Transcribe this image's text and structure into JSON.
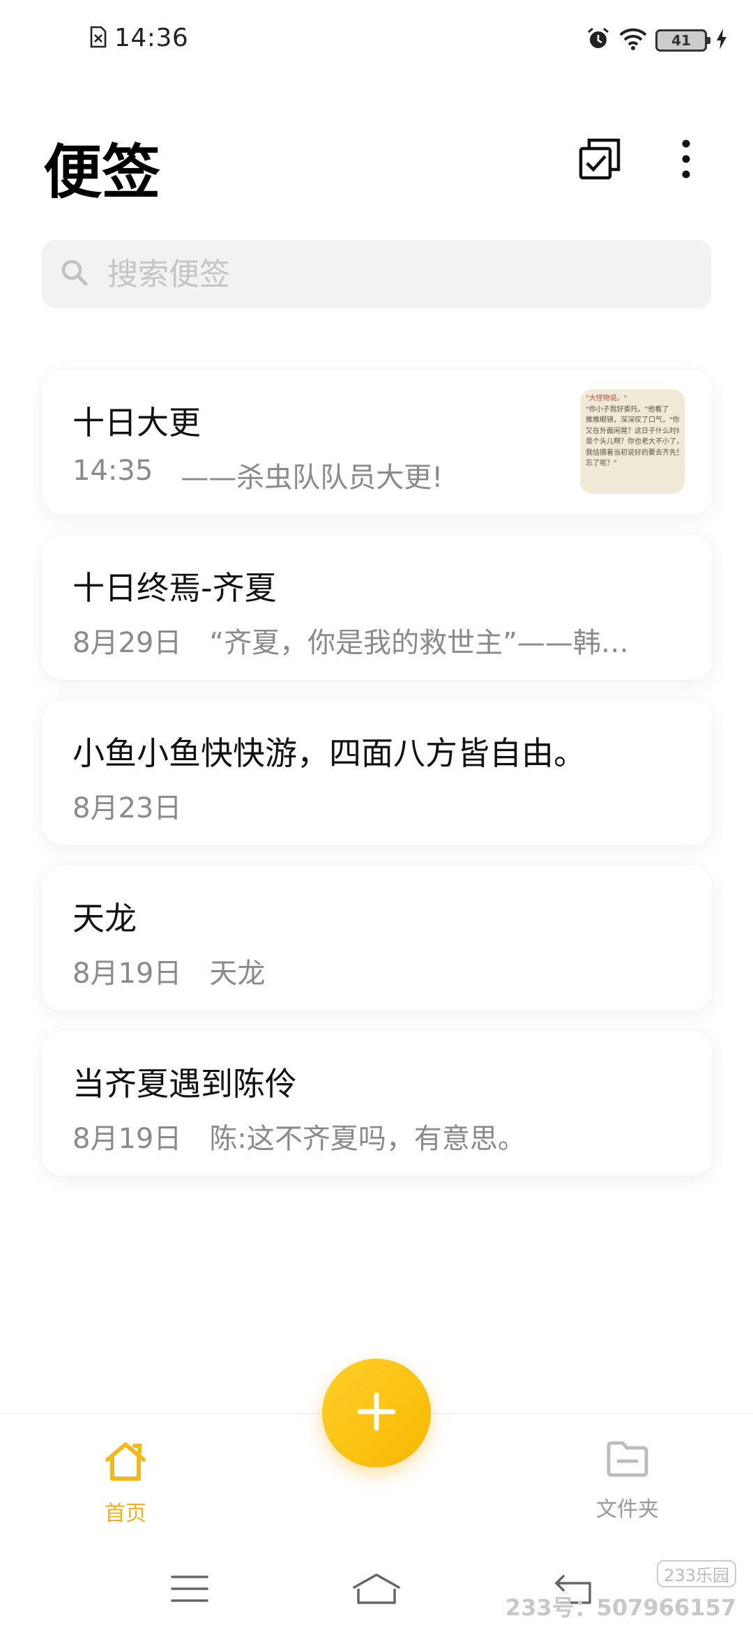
{
  "status_bar": {
    "time": "14:36",
    "battery": "41",
    "icons": [
      "sim-off-icon",
      "alarm-icon",
      "wifi-icon",
      "battery-icon",
      "charging-icon"
    ]
  },
  "header": {
    "title": "便签",
    "actions": [
      "multi-select-icon",
      "more-vert-icon"
    ]
  },
  "search": {
    "placeholder": "搜索便签"
  },
  "notes": [
    {
      "title": "十日大更",
      "date": "14:35",
      "preview": "——杀虫队队员大更!",
      "thumbnail": {
        "lines": [
          "\"大怪物说。\"",
          "\"你小子我好委托。\"他看了",
          "推推眼镜，深深叹了口气，\"你今儿",
          "又在外面闲晃？这日子什么时候",
          "是个头儿啊？你也老大不小了，",
          "我估摸着当初说好的要去齐先生",
          "忘了呢？\""
        ]
      }
    },
    {
      "title": "十日终焉-齐夏",
      "date": "8月29日",
      "preview": "“齐夏，你是我的救世主”——韩…"
    },
    {
      "title": "小鱼小鱼快快游，四面八方皆自由。",
      "date": "8月23日",
      "preview": ""
    },
    {
      "title": "天龙",
      "date": "8月19日",
      "preview": "天龙"
    },
    {
      "title": "当齐夏遇到陈伶",
      "date": "8月19日",
      "preview": "陈:这不齐夏吗，有意思。"
    }
  ],
  "bottom_nav": {
    "home_label": "首页",
    "folder_label": "文件夹"
  },
  "watermark": {
    "logo": "233乐园",
    "text": "233号：507966157"
  },
  "colors": {
    "accent": "#f5b81c",
    "search_bg": "#f2f2f2",
    "meta_text": "#8a8a8a"
  }
}
